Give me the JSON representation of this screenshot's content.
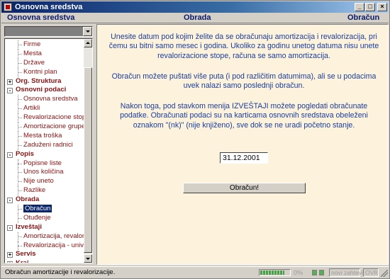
{
  "window": {
    "title": "Osnovna sredstva"
  },
  "header": {
    "left": "Osnovna sredstva",
    "center": "Obrada",
    "right": "Obračun"
  },
  "tree": {
    "items": [
      {
        "label": "Firme",
        "level": 1
      },
      {
        "label": "Mesta",
        "level": 1
      },
      {
        "label": "Države",
        "level": 1
      },
      {
        "label": "Kontni plan",
        "level": 1
      },
      {
        "label": "Org. Struktura",
        "level": 0,
        "expander": "+"
      },
      {
        "label": "Osnovni podaci",
        "level": 0,
        "expander": "−"
      },
      {
        "label": "Osnovna sredstva",
        "level": 1
      },
      {
        "label": "Artikli",
        "level": 1
      },
      {
        "label": "Revalorizacione stope",
        "level": 1
      },
      {
        "label": "Amortizacione grupe",
        "level": 1
      },
      {
        "label": "Mesta troška",
        "level": 1
      },
      {
        "label": "Zaduženi radnici",
        "level": 1
      },
      {
        "label": "Popis",
        "level": 0,
        "expander": "−"
      },
      {
        "label": "Popisne liste",
        "level": 1
      },
      {
        "label": "Unos količina",
        "level": 1
      },
      {
        "label": "Nije uneto",
        "level": 1
      },
      {
        "label": "Razlike",
        "level": 1
      },
      {
        "label": "Obrada",
        "level": 0,
        "expander": "−"
      },
      {
        "label": "Obračun",
        "level": 1,
        "selected": true
      },
      {
        "label": "Otuđenje",
        "level": 1
      },
      {
        "label": "Izveštaji",
        "level": 0,
        "expander": "−"
      },
      {
        "label": "Amortizacija, revalorizacija",
        "level": 1
      },
      {
        "label": "Revalorizacija - univerzalno",
        "level": 1
      },
      {
        "label": "Servis",
        "level": 0,
        "expander": "+"
      },
      {
        "label": "Kraj",
        "level": 0,
        "expander": "+"
      }
    ]
  },
  "main": {
    "paragraph1": "Unesite datum pod kojim želite da se obračunaju amortizacija i revalorizacija, pri čemu su bitni samo mesec i godina. Ukoliko za godinu unetog datuma nisu unete revalorizacione stope, računa se samo amortizacija.",
    "paragraph2": "Obračun možete puštati više puta (i pod različitim datumima), ali se u podacima uvek nalazi samo poslednji obračun.",
    "paragraph3": "Nakon toga, pod stavkom menija IZVEŠTAJI možete pogledati obračunate podatke. Obračunati podaci su na karticama osnovnih sredstava obeleženi oznakom \"(nk)\" (nije knjiženo), sve dok se ne uradi početno stanje.",
    "date_value": "31.12.2001",
    "calc_button": "Obračun!"
  },
  "status": {
    "text": "Obračun amortizacije i revalorizacije.",
    "progress_percent": 0.82,
    "percent_label": "0%",
    "box1": "novi zahtevi",
    "box2": "OVR"
  },
  "colors": {
    "accent_text": "#1a3c9c",
    "tree_text": "#8b1010",
    "content_bg": "#fdf3dc"
  }
}
